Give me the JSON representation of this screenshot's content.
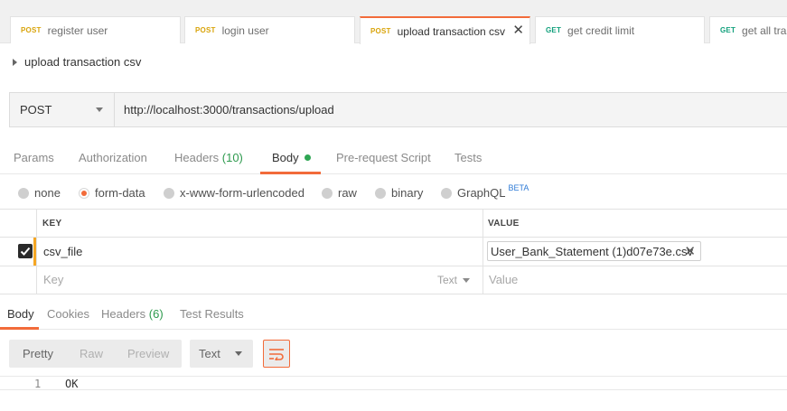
{
  "tabs": [
    {
      "method": "POST",
      "name": "register user",
      "active": false
    },
    {
      "method": "POST",
      "name": "login user",
      "active": false
    },
    {
      "method": "POST",
      "name": "upload transaction csv",
      "active": true
    },
    {
      "method": "GET",
      "name": "get credit limit",
      "active": false
    },
    {
      "method": "GET",
      "name": "get all tran",
      "active": false
    }
  ],
  "request": {
    "title": "upload transaction csv",
    "method": "POST",
    "url": "http://localhost:3000/transactions/upload"
  },
  "request_tabs": {
    "params": "Params",
    "authorization": "Authorization",
    "headers_label": "Headers",
    "headers_count": "(10)",
    "body": "Body",
    "pre_request": "Pre-request Script",
    "tests": "Tests"
  },
  "body_types": {
    "none": "none",
    "form_data": "form-data",
    "urlencoded": "x-www-form-urlencoded",
    "raw": "raw",
    "binary": "binary",
    "graphql": "GraphQL",
    "beta": "BETA",
    "selected": "form-data"
  },
  "form": {
    "key_header": "KEY",
    "value_header": "VALUE",
    "rows": [
      {
        "checked": true,
        "key": "csv_file",
        "file": "User_Bank_Statement (1)d07e73e.csv"
      }
    ],
    "key_placeholder": "Key",
    "value_placeholder": "Value",
    "type_label": "Text"
  },
  "response": {
    "tabs": {
      "body": "Body",
      "cookies": "Cookies",
      "headers_label": "Headers",
      "headers_count": "(6)",
      "test_results": "Test Results"
    },
    "views": {
      "pretty": "Pretty",
      "raw": "Raw",
      "preview": "Preview"
    },
    "format": "Text",
    "lines": [
      {
        "num": "1",
        "code": "OK"
      }
    ]
  },
  "colors": {
    "accent": "#f26b3a",
    "post": "#d9a40b",
    "get": "#12a07c",
    "count_green": "#2e9a4e",
    "beta_blue": "#2f7bd6"
  }
}
